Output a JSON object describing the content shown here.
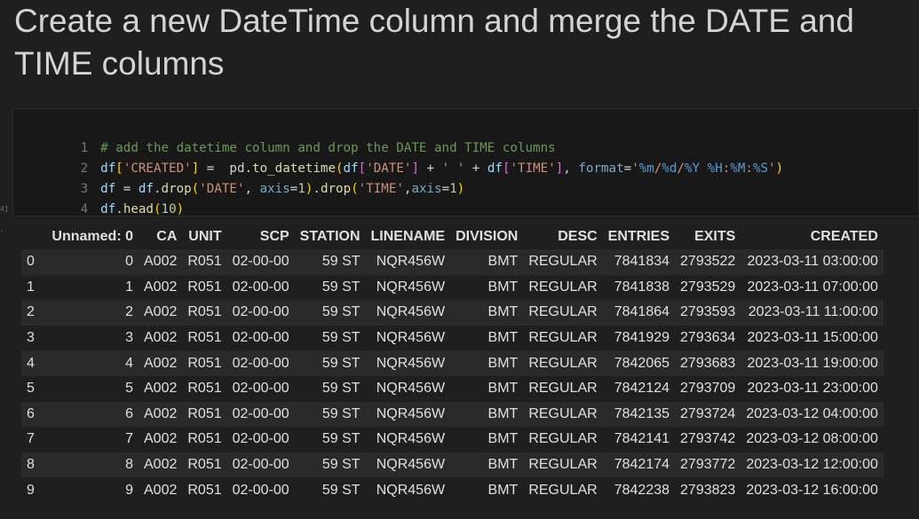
{
  "heading": "Create a new DateTime column and merge the DATE and TIME columns",
  "cell_markers": [
    "4]",
    "."
  ],
  "code": {
    "line_numbers": [
      "1",
      "2",
      "3",
      "4"
    ],
    "lines": [
      [
        {
          "t": "# add the datetime column and drop the DATE and TIME columns",
          "c": "t-comment"
        }
      ],
      [
        {
          "t": "df",
          "c": "t-var"
        },
        {
          "t": "[",
          "c": "t-brace1"
        },
        {
          "t": "'CREATED'",
          "c": "t-str"
        },
        {
          "t": "]",
          "c": "t-brace1"
        },
        {
          "t": " =  pd.",
          "c": "t-op"
        },
        {
          "t": "to_datetime",
          "c": "t-fn"
        },
        {
          "t": "(",
          "c": "t-brace1"
        },
        {
          "t": "df",
          "c": "t-var"
        },
        {
          "t": "[",
          "c": "t-brace2"
        },
        {
          "t": "'DATE'",
          "c": "t-str"
        },
        {
          "t": "]",
          "c": "t-brace2"
        },
        {
          "t": " + ",
          "c": "t-op"
        },
        {
          "t": "' '",
          "c": "t-str"
        },
        {
          "t": " + ",
          "c": "t-op"
        },
        {
          "t": "df",
          "c": "t-var"
        },
        {
          "t": "[",
          "c": "t-brace2"
        },
        {
          "t": "'TIME'",
          "c": "t-str"
        },
        {
          "t": "]",
          "c": "t-brace2"
        },
        {
          "t": ", ",
          "c": "t-op"
        },
        {
          "t": "format",
          "c": "t-param"
        },
        {
          "t": "=",
          "c": "t-op"
        },
        {
          "t": "'",
          "c": "t-str"
        },
        {
          "t": "%m",
          "c": "t-pct"
        },
        {
          "t": "/",
          "c": "t-str"
        },
        {
          "t": "%d",
          "c": "t-pct"
        },
        {
          "t": "/",
          "c": "t-str"
        },
        {
          "t": "%Y",
          "c": "t-pct"
        },
        {
          "t": " ",
          "c": "t-str"
        },
        {
          "t": "%H",
          "c": "t-pct"
        },
        {
          "t": ":",
          "c": "t-str"
        },
        {
          "t": "%M",
          "c": "t-pct"
        },
        {
          "t": ":",
          "c": "t-str"
        },
        {
          "t": "%S",
          "c": "t-pct"
        },
        {
          "t": "'",
          "c": "t-str"
        },
        {
          "t": ")",
          "c": "t-brace1"
        }
      ],
      [
        {
          "t": "df",
          "c": "t-var"
        },
        {
          "t": " = ",
          "c": "t-op"
        },
        {
          "t": "df",
          "c": "t-var"
        },
        {
          "t": ".",
          "c": "t-op"
        },
        {
          "t": "drop",
          "c": "t-fn"
        },
        {
          "t": "(",
          "c": "t-brace1"
        },
        {
          "t": "'DATE'",
          "c": "t-str"
        },
        {
          "t": ", ",
          "c": "t-op"
        },
        {
          "t": "axis",
          "c": "t-param"
        },
        {
          "t": "=",
          "c": "t-op"
        },
        {
          "t": "1",
          "c": "t-num"
        },
        {
          "t": ")",
          "c": "t-brace1"
        },
        {
          "t": ".",
          "c": "t-op"
        },
        {
          "t": "drop",
          "c": "t-fn"
        },
        {
          "t": "(",
          "c": "t-brace1"
        },
        {
          "t": "'TIME'",
          "c": "t-str"
        },
        {
          "t": ",",
          "c": "t-op"
        },
        {
          "t": "axis",
          "c": "t-param"
        },
        {
          "t": "=",
          "c": "t-op"
        },
        {
          "t": "1",
          "c": "t-num"
        },
        {
          "t": ")",
          "c": "t-brace1"
        }
      ],
      [
        {
          "t": "df",
          "c": "t-var"
        },
        {
          "t": ".",
          "c": "t-op"
        },
        {
          "t": "head",
          "c": "t-fn"
        },
        {
          "t": "(",
          "c": "t-brace1"
        },
        {
          "t": "10",
          "c": "t-num"
        },
        {
          "t": ")",
          "c": "t-brace1"
        }
      ]
    ]
  },
  "table": {
    "columns": [
      "",
      "Unnamed: 0",
      "CA",
      "UNIT",
      "SCP",
      "STATION",
      "LINENAME",
      "DIVISION",
      "DESC",
      "ENTRIES",
      "EXITS",
      "CREATED"
    ],
    "rows": [
      [
        "0",
        "0",
        "A002",
        "R051",
        "02-00-00",
        "59 ST",
        "NQR456W",
        "BMT",
        "REGULAR",
        "7841834",
        "2793522",
        "2023-03-11 03:00:00"
      ],
      [
        "1",
        "1",
        "A002",
        "R051",
        "02-00-00",
        "59 ST",
        "NQR456W",
        "BMT",
        "REGULAR",
        "7841838",
        "2793529",
        "2023-03-11 07:00:00"
      ],
      [
        "2",
        "2",
        "A002",
        "R051",
        "02-00-00",
        "59 ST",
        "NQR456W",
        "BMT",
        "REGULAR",
        "7841864",
        "2793593",
        "2023-03-11 11:00:00"
      ],
      [
        "3",
        "3",
        "A002",
        "R051",
        "02-00-00",
        "59 ST",
        "NQR456W",
        "BMT",
        "REGULAR",
        "7841929",
        "2793634",
        "2023-03-11 15:00:00"
      ],
      [
        "4",
        "4",
        "A002",
        "R051",
        "02-00-00",
        "59 ST",
        "NQR456W",
        "BMT",
        "REGULAR",
        "7842065",
        "2793683",
        "2023-03-11 19:00:00"
      ],
      [
        "5",
        "5",
        "A002",
        "R051",
        "02-00-00",
        "59 ST",
        "NQR456W",
        "BMT",
        "REGULAR",
        "7842124",
        "2793709",
        "2023-03-11 23:00:00"
      ],
      [
        "6",
        "6",
        "A002",
        "R051",
        "02-00-00",
        "59 ST",
        "NQR456W",
        "BMT",
        "REGULAR",
        "7842135",
        "2793724",
        "2023-03-12 04:00:00"
      ],
      [
        "7",
        "7",
        "A002",
        "R051",
        "02-00-00",
        "59 ST",
        "NQR456W",
        "BMT",
        "REGULAR",
        "7842141",
        "2793742",
        "2023-03-12 08:00:00"
      ],
      [
        "8",
        "8",
        "A002",
        "R051",
        "02-00-00",
        "59 ST",
        "NQR456W",
        "BMT",
        "REGULAR",
        "7842174",
        "2793772",
        "2023-03-12 12:00:00"
      ],
      [
        "9",
        "9",
        "A002",
        "R051",
        "02-00-00",
        "59 ST",
        "NQR456W",
        "BMT",
        "REGULAR",
        "7842238",
        "2793823",
        "2023-03-12 16:00:00"
      ]
    ]
  }
}
